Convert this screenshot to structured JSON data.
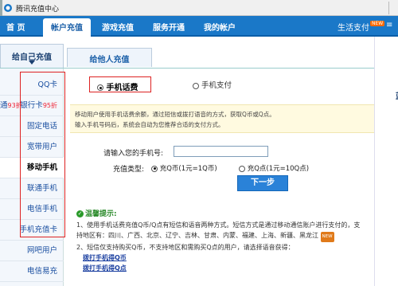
{
  "window": {
    "title": "腾讯充值中心"
  },
  "nav": {
    "items": [
      {
        "label": "首 页"
      },
      {
        "label": "帐户充值"
      },
      {
        "label": "游戏充值"
      },
      {
        "label": "服务开通"
      },
      {
        "label": "我的帐户"
      }
    ],
    "right_label": "生活支付",
    "right_badge": "NEW",
    "right_label2": "≡"
  },
  "tabs": {
    "left": "给自己充值",
    "right": "给他人充值"
  },
  "sidebar": {
    "items": [
      {
        "label": "QQ卡",
        "pre": "",
        "disc": ""
      },
      {
        "label": "银行卡",
        "pre": "通",
        "pre_disc": "93折",
        "disc": "95折"
      },
      {
        "label": "固定电话"
      },
      {
        "label": "宽带用户"
      },
      {
        "label": "移动手机"
      },
      {
        "label": "联通手机"
      },
      {
        "label": "电信手机"
      },
      {
        "label": "手机充值卡"
      },
      {
        "label": "网吧用户"
      },
      {
        "label": "电信易充"
      }
    ]
  },
  "payment": {
    "option_fee": "手机话费",
    "option_pay": "手机支付",
    "info_line1": "移动用户使用手机话费余额，通过短信或拨打语音的方式，获取Q币或Q点。",
    "info_line2": "输入手机号码后，系统会自动为您推荐合适的支付方式。",
    "phone_label": "请输入您的手机号:",
    "phone_value": "",
    "type_label": "充值类型:",
    "type_q_coin": "充Q币(1元=1Q币)",
    "type_q_point": "充Q点(1元=10Q点)",
    "next_button": "下一步"
  },
  "tips": {
    "title": "温馨提示:",
    "line1a": "1、使用手机话费充值Q币/Q点有短信和语音两种方式。短信方式是通过移动通信账户进行支付的，支",
    "line1b": "持地区有：四川、广西、北京、辽宁、吉林、甘肃、内蒙、福建、上海、新疆、黑龙江",
    "badge": "NEW",
    "line2": "2、短信仅支持购买Q币，不支持地区和需购买Q点的用户，请选择语音获得：",
    "link1": "拨打手机得Q币",
    "link2": "拨打手机得Q点"
  },
  "right_col": {
    "label": "蓝"
  }
}
